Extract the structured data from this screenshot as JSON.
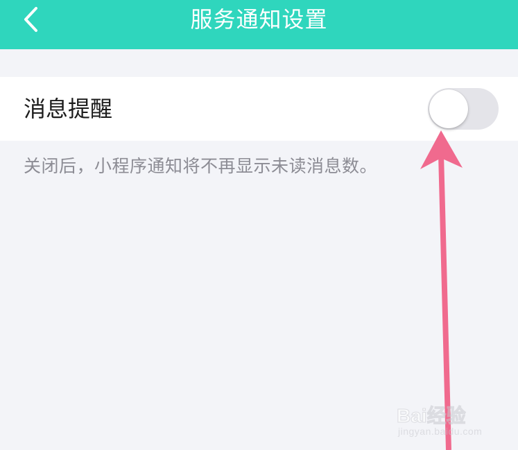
{
  "header": {
    "back_icon": "chevron-left-icon",
    "title": "服务通知设置",
    "bg_color": "#2fd6bd"
  },
  "settings": {
    "notification_toggle": {
      "label": "消息提醒",
      "state": "off"
    },
    "hint_text": "关闭后，小程序通知将不再显示未读消息数。"
  },
  "annotation": {
    "arrow_color": "#f06a8e"
  },
  "watermark": {
    "brand_text": "Bai经验",
    "url_text": "jingyan.baidu.com"
  }
}
